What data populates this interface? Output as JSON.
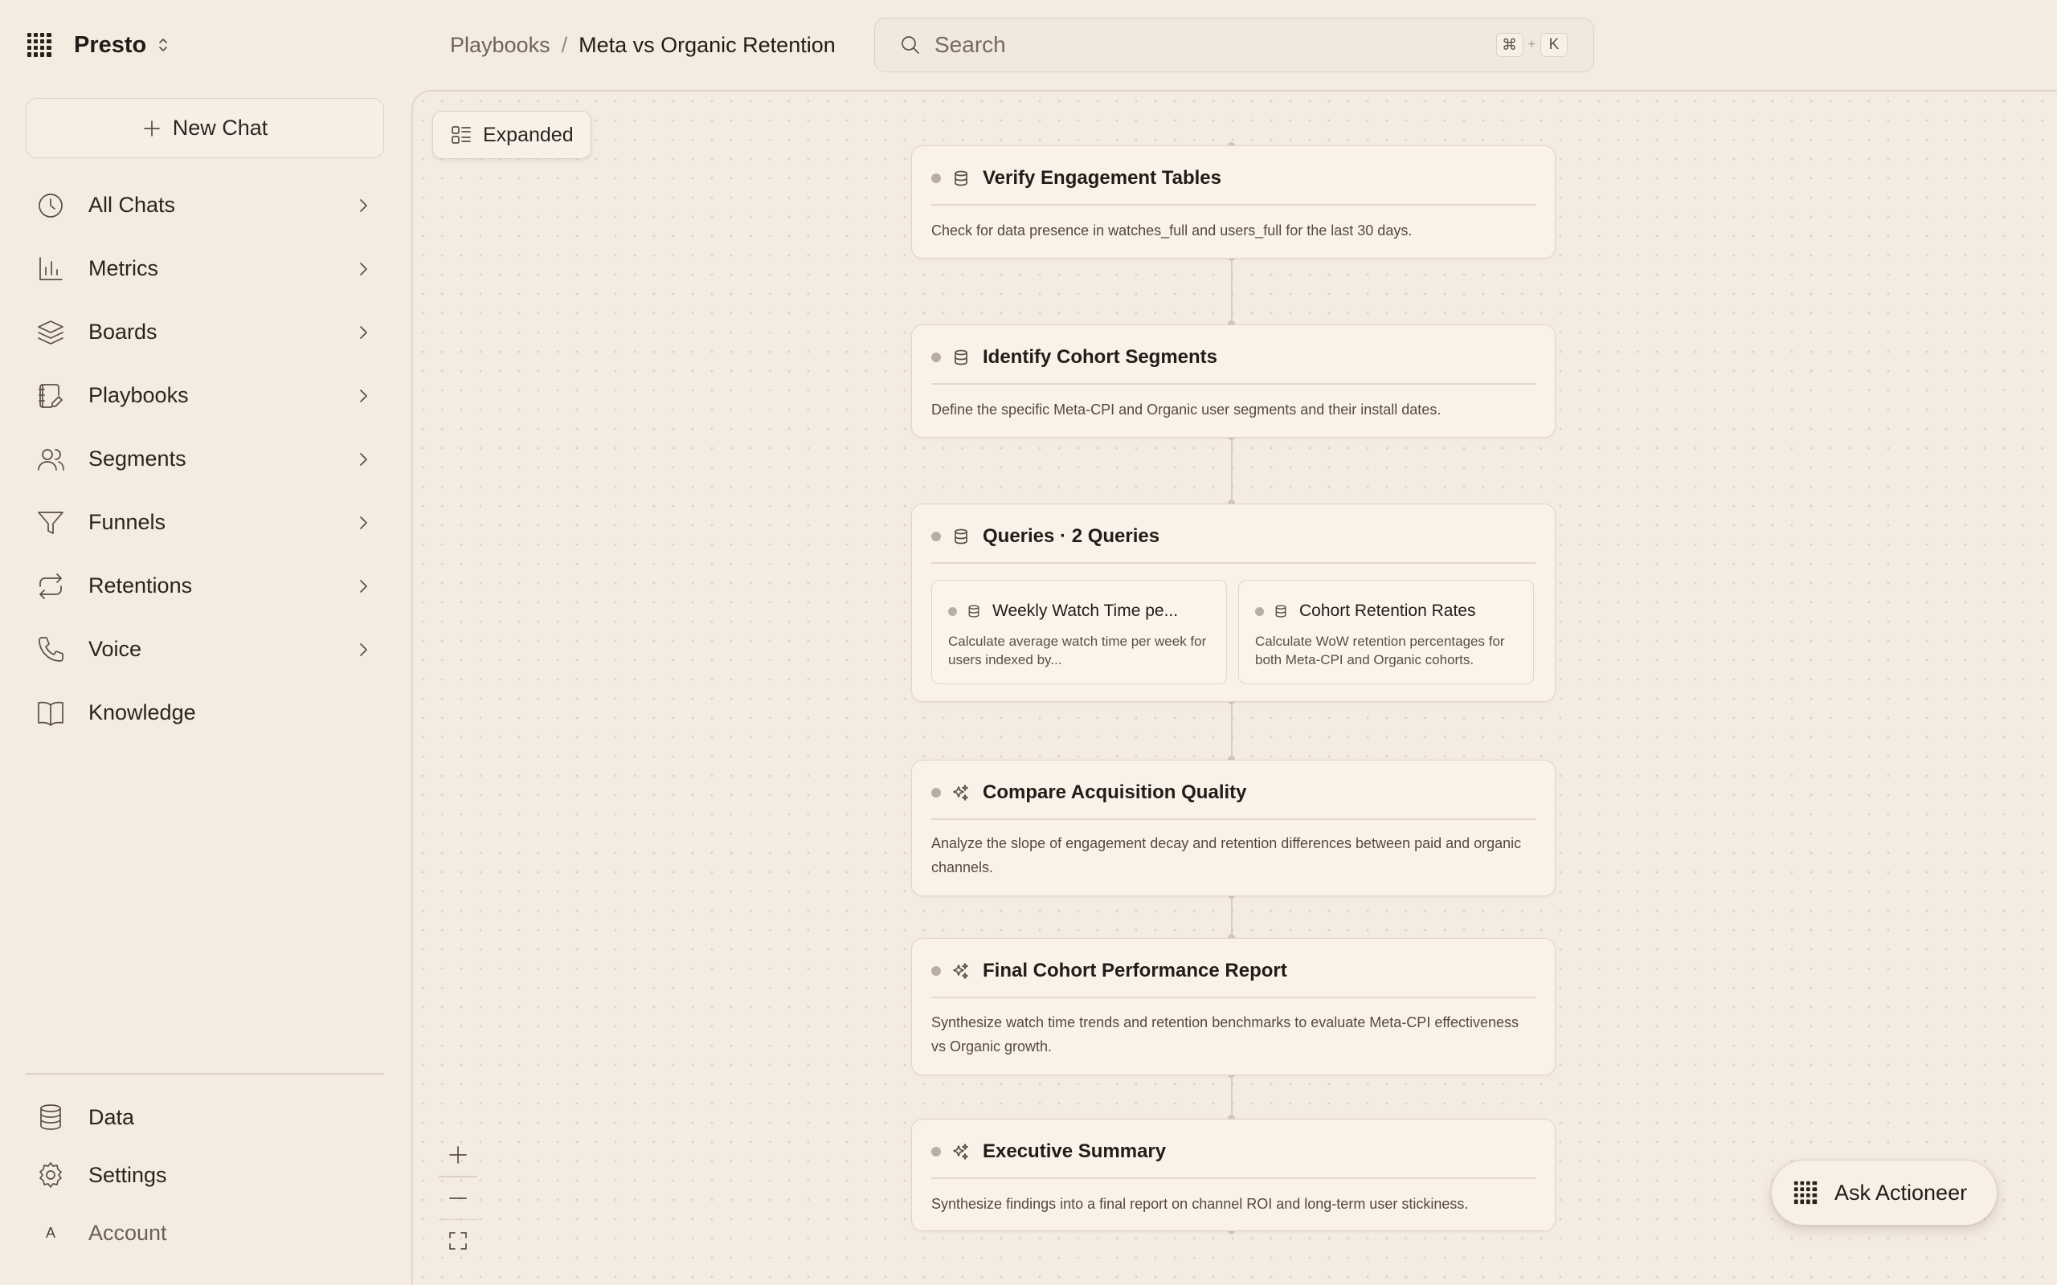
{
  "app": {
    "name": "Presto"
  },
  "sidebar": {
    "new_chat_label": "New Chat",
    "items": [
      {
        "label": "All Chats",
        "icon": "clock-icon",
        "has_chevron": true
      },
      {
        "label": "Metrics",
        "icon": "bar-chart-icon",
        "has_chevron": true
      },
      {
        "label": "Boards",
        "icon": "layers-icon",
        "has_chevron": true
      },
      {
        "label": "Playbooks",
        "icon": "notebook-icon",
        "has_chevron": true
      },
      {
        "label": "Segments",
        "icon": "users-icon",
        "has_chevron": true
      },
      {
        "label": "Funnels",
        "icon": "funnel-icon",
        "has_chevron": true
      },
      {
        "label": "Retentions",
        "icon": "repeat-icon",
        "has_chevron": true
      },
      {
        "label": "Voice",
        "icon": "phone-icon",
        "has_chevron": true
      },
      {
        "label": "Knowledge",
        "icon": "book-icon",
        "has_chevron": false
      }
    ],
    "bottom": {
      "data_label": "Data",
      "settings_label": "Settings",
      "account_label": "Account",
      "account_initial": "A"
    }
  },
  "header": {
    "breadcrumb": [
      "Playbooks",
      "Meta vs Organic Retention"
    ],
    "breadcrumb_separator": "/",
    "search_placeholder": "Search",
    "shortcut_keys": [
      "⌘",
      "K"
    ],
    "shortcut_joiner": "+"
  },
  "canvas": {
    "view_mode_label": "Expanded",
    "steps": [
      {
        "title": "Verify Engagement Tables",
        "icon": "database-icon",
        "description": "Check for data presence in watches_full and users_full for the last 30 days."
      },
      {
        "title": "Identify Cohort Segments",
        "icon": "database-icon",
        "description": "Define the specific Meta-CPI and Organic user segments and their install dates."
      },
      {
        "title": "Queries · 2 Queries",
        "icon": "database-icon",
        "queries": [
          {
            "title": "Weekly Watch Time pe...",
            "icon": "database-icon",
            "description": "Calculate average watch time per week for users indexed by..."
          },
          {
            "title": "Cohort Retention Rates",
            "icon": "database-icon",
            "description": "Calculate WoW retention percentages for both Meta-CPI and Organic cohorts."
          }
        ]
      },
      {
        "title": "Compare Acquisition Quality",
        "icon": "sparkles-icon",
        "description": "Analyze the slope of engagement decay and retention differences between paid and organic channels."
      },
      {
        "title": "Final Cohort Performance Report",
        "icon": "sparkles-icon",
        "description": "Synthesize watch time trends and retention benchmarks to evaluate Meta-CPI effectiveness vs Organic growth."
      },
      {
        "title": "Executive Summary",
        "icon": "sparkles-icon",
        "description": "Synthesize findings into a final report on channel ROI and long-term user stickiness."
      }
    ]
  },
  "assistant": {
    "label": "Ask Actioneer"
  },
  "colors": {
    "background": "#f4ebe1",
    "card": "#faf2e9",
    "border": "#e2d5c7",
    "text": "#221b17"
  }
}
